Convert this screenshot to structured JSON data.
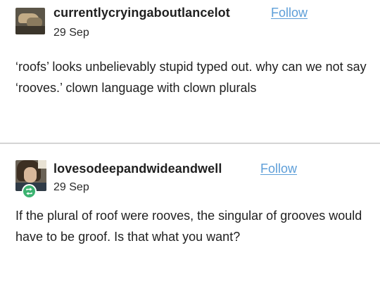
{
  "posts": [
    {
      "username": "currentlycryingaboutlancelot",
      "follow_label": "Follow",
      "date": "29 Sep",
      "text": "‘roofs’ looks unbelievably stupid typed out. why can we not say ‘rooves.’ clown language with clown plurals",
      "avatar_icon": "user-avatar-icon"
    },
    {
      "username": "lovesodeepandwideandwell",
      "follow_label": "Follow",
      "date": "29 Sep",
      "text": "If the plural of roof were rooves, the singular of grooves would have to be groof. Is that what you want?",
      "avatar_icon": "user-avatar-icon",
      "badge_icon": "reblog-icon",
      "badge_color": "#3cb371"
    }
  ],
  "colors": {
    "follow_link": "#5d9ed8",
    "text": "#1f1f1f",
    "divider": "#d4d4d4"
  }
}
